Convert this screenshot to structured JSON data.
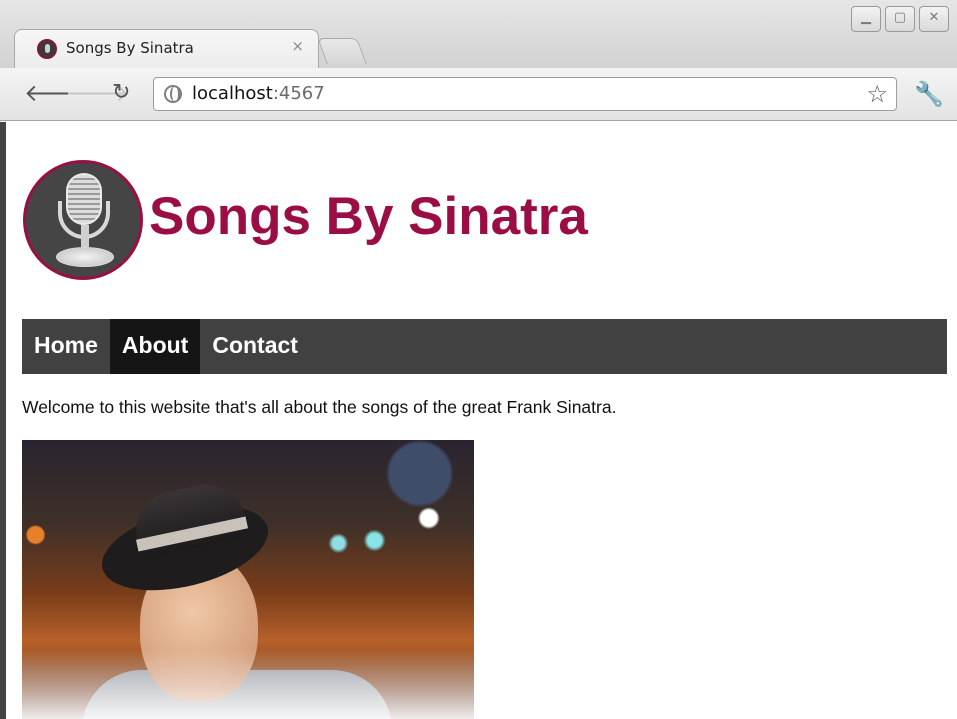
{
  "browser": {
    "tab_title": "Songs By Sinatra",
    "tab_close": "×",
    "url_host": "localhost",
    "url_port": ":4567"
  },
  "site": {
    "title": "Songs By Sinatra",
    "nav": [
      {
        "label": "Home",
        "active": false
      },
      {
        "label": "About",
        "active": true
      },
      {
        "label": "Contact",
        "active": false
      }
    ],
    "welcome_text": "Welcome to this website that's all about the songs of the great Frank Sinatra."
  },
  "colors": {
    "brand": "#9b0e45",
    "nav_bg": "#414141",
    "nav_active_bg": "#151515"
  }
}
